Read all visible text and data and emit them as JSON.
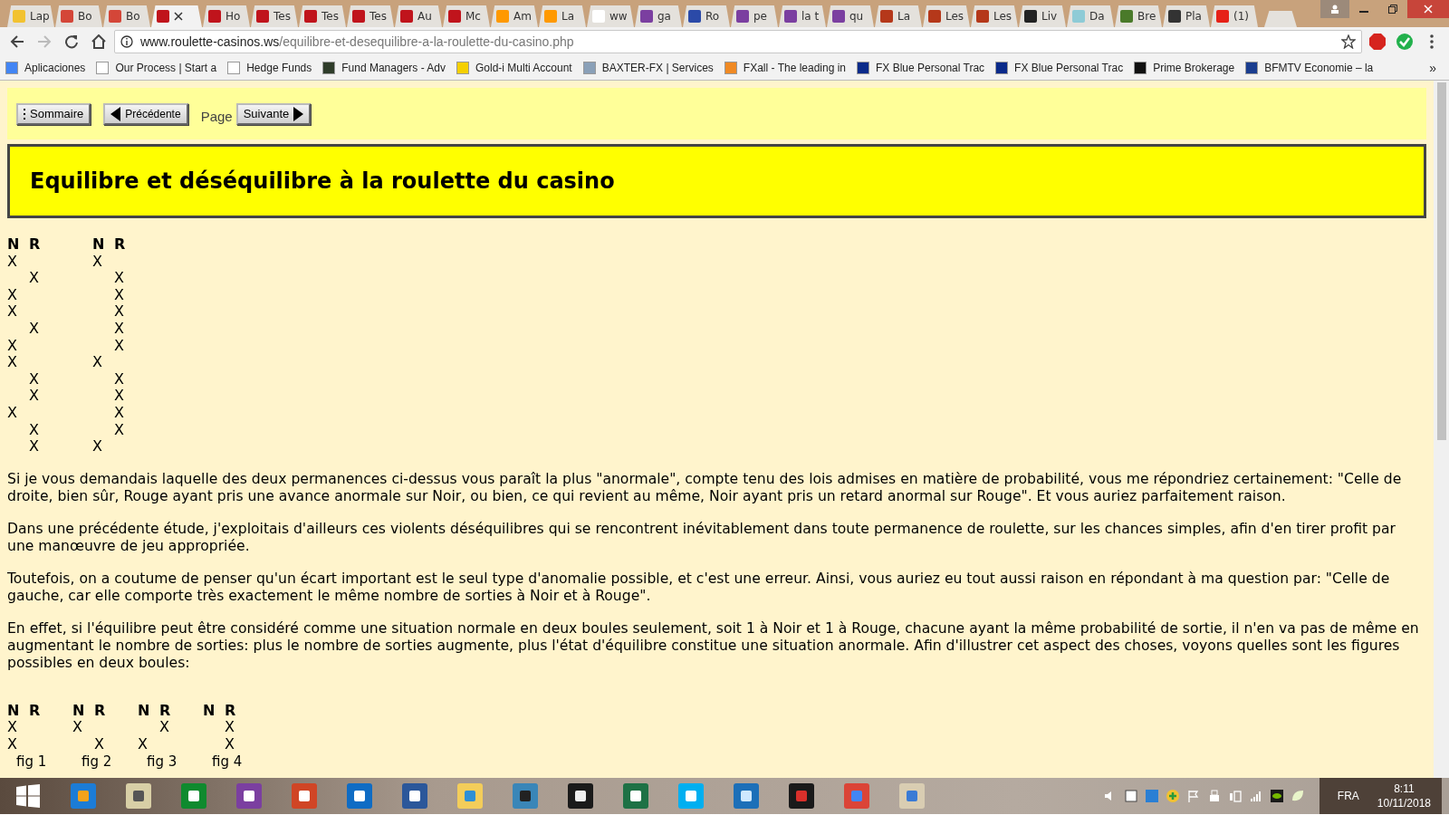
{
  "tabs": [
    {
      "title": "Lap",
      "color": "#f2c230",
      "selected": false
    },
    {
      "title": "Bo",
      "color": "#d44638",
      "selected": false
    },
    {
      "title": "Bo",
      "color": "#d44638",
      "selected": false
    },
    {
      "color": "#c0141c",
      "selected": true
    },
    {
      "title": "Ho",
      "color": "#c0141c",
      "selected": false
    },
    {
      "title": "Tes",
      "color": "#c0141c",
      "selected": false
    },
    {
      "title": "Tes",
      "color": "#c0141c",
      "selected": false
    },
    {
      "title": "Tes",
      "color": "#c0141c",
      "selected": false
    },
    {
      "title": "Au",
      "color": "#c0141c",
      "selected": false
    },
    {
      "title": "Mc",
      "color": "#c0141c",
      "selected": false
    },
    {
      "title": "Am",
      "color": "#ff9900",
      "selected": false
    },
    {
      "title": "La",
      "color": "#ff9900",
      "selected": false
    },
    {
      "title": "ww",
      "color": "#ffffff",
      "selected": false
    },
    {
      "title": "ga",
      "color": "#7b3fa0",
      "selected": false
    },
    {
      "title": "Ro",
      "color": "#2b4aa8",
      "selected": false
    },
    {
      "title": "pe",
      "color": "#7b3fa0",
      "selected": false
    },
    {
      "title": "la t",
      "color": "#7b3fa0",
      "selected": false
    },
    {
      "title": "qu",
      "color": "#7b3fa0",
      "selected": false
    },
    {
      "title": "La",
      "color": "#b5381a",
      "selected": false
    },
    {
      "title": "Les",
      "color": "#b5381a",
      "selected": false
    },
    {
      "title": "Les",
      "color": "#b5381a",
      "selected": false
    },
    {
      "title": "Liv",
      "color": "#222222",
      "selected": false
    },
    {
      "title": "Da",
      "color": "#8ecbd6",
      "selected": false
    },
    {
      "title": "Bre",
      "color": "#4a7a2a",
      "selected": false
    },
    {
      "title": "Pla",
      "color": "#333333",
      "selected": false
    },
    {
      "title": "(1)",
      "color": "#e62117",
      "selected": false
    }
  ],
  "address_bar": {
    "domain": "www.roulette-casinos.ws",
    "path": "/equilibre-et-desequilibre-a-la-roulette-du-casino.php"
  },
  "bookmarks": [
    {
      "label": "Aplicaciones",
      "color": "#4285f4"
    },
    {
      "label": "Our Process | Start a",
      "color": "#ffffff"
    },
    {
      "label": "Hedge Funds",
      "color": "#ffffff"
    },
    {
      "label": "Fund Managers - Adv",
      "color": "#2f3d2a"
    },
    {
      "label": "Gold-i Multi Account",
      "color": "#f5d000"
    },
    {
      "label": "BAXTER-FX | Services",
      "color": "#8aa0b8"
    },
    {
      "label": "FXall - The leading in",
      "color": "#f08a24"
    },
    {
      "label": "FX Blue Personal Trac",
      "color": "#0a2a8a"
    },
    {
      "label": "FX Blue Personal Trac",
      "color": "#0a2a8a"
    },
    {
      "label": "Prime Brokerage",
      "color": "#111111"
    },
    {
      "label": "BFMTV Economie – la",
      "color": "#1a3d8f"
    }
  ],
  "bookmarks_more": "»",
  "nav": {
    "summary": "Sommaire",
    "previous": "Précédente",
    "page_label": "Page",
    "next": "Suivante"
  },
  "title": "Equilibre et déséquilibre à la roulette du casino",
  "permanences": [
    {
      "headers": [
        "N",
        "R"
      ],
      "rows": [
        {
          "n": "X"
        },
        {
          "r": "X"
        },
        {
          "n": "X"
        },
        {
          "n": "X"
        },
        {
          "r": "X"
        },
        {
          "n": "X"
        },
        {
          "n": "X"
        },
        {
          "r": "X"
        },
        {
          "r": "X"
        },
        {
          "n": "X"
        },
        {
          "r": "X"
        },
        {
          "r": "X"
        }
      ]
    },
    {
      "headers": [
        "N",
        "R"
      ],
      "rows": [
        {
          "n": "X"
        },
        {
          "r": "X"
        },
        {
          "r": "X"
        },
        {
          "r": "X"
        },
        {
          "r": "X"
        },
        {
          "r": "X"
        },
        {
          "n": "X"
        },
        {
          "r": "X"
        },
        {
          "r": "X"
        },
        {
          "r": "X"
        },
        {
          "r": "X"
        },
        {
          "n": "X"
        }
      ]
    }
  ],
  "paragraphs": [
    "Si je vous demandais laquelle des deux permanences ci-dessus vous paraît la plus \"anormale\", compte tenu des lois admises en matière de probabilité, vous me répondriez certainement: \"Celle de droite, bien sûr, Rouge ayant pris une avance anormale sur Noir, ou bien, ce qui revient au même, Noir ayant pris un retard anormal sur Rouge\". Et vous auriez parfaitement raison.",
    "Dans une précédente étude, j'exploitais d'ailleurs ces violents déséquilibres qui se rencontrent inévitablement dans toute permanence de roulette, sur les chances simples, afin d'en tirer profit par une manœuvre de jeu appropriée.",
    "Toutefois, on a coutume de penser qu'un écart important est le seul type d'anomalie possible, et c'est une erreur. Ainsi, vous auriez eu tout aussi raison en répondant à ma question par: \"Celle de gauche, car elle comporte très exactement le même nombre de sorties à Noir et à Rouge\".",
    "En effet, si l'équilibre peut être considéré comme une situation normale en deux boules seulement, soit 1 à Noir et 1 à Rouge, chacune ayant la même probabilité de sortie, il n'en va pas de même en augmentant le nombre de sorties: plus le nombre de sorties augmente, plus l'état d'équilibre constitue une situation anormale. Afin d'illustrer cet aspect des choses, voyons quelles sont les figures possibles en deux boules:"
  ],
  "figures": [
    {
      "headers": [
        "N",
        "R"
      ],
      "rows": [
        {
          "n": "X"
        },
        {
          "n": "X"
        }
      ],
      "caption": "fig 1"
    },
    {
      "headers": [
        "N",
        "R"
      ],
      "rows": [
        {
          "n": "X"
        },
        {
          "r": "X"
        }
      ],
      "caption": "fig 2"
    },
    {
      "headers": [
        "N",
        "R"
      ],
      "rows": [
        {
          "r": "X"
        },
        {
          "n": "X"
        }
      ],
      "caption": "fig 3"
    },
    {
      "headers": [
        "N",
        "R"
      ],
      "rows": [
        {
          "r": "X"
        },
        {
          "r": "X"
        }
      ],
      "caption": "fig 4"
    }
  ],
  "tray": {
    "language": "FRA",
    "time": "8:11",
    "date": "10/11/2018"
  }
}
